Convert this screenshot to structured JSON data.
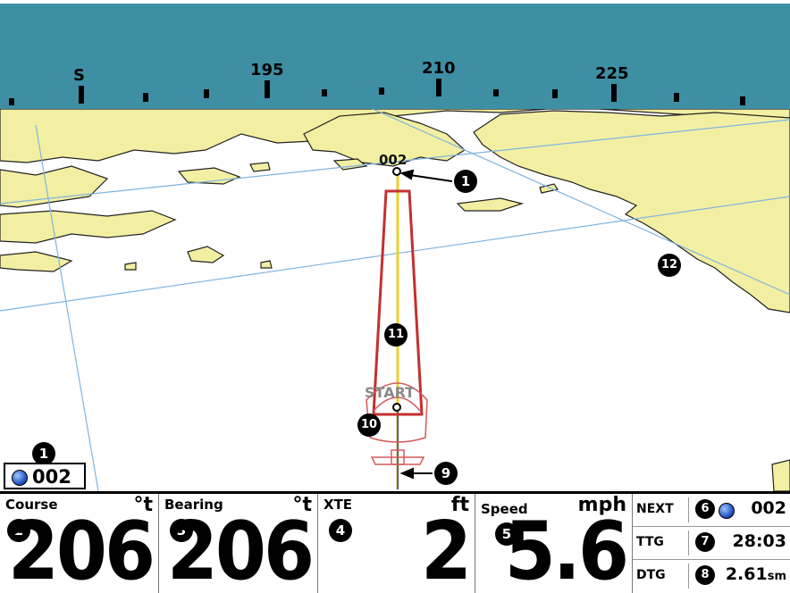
{
  "compass": {
    "labels": [
      "S",
      "195",
      "210",
      "225"
    ]
  },
  "map": {
    "waypoint_label": "002",
    "start_label": "START"
  },
  "callouts": [
    "1",
    "1",
    "2",
    "3",
    "4",
    "5",
    "6",
    "7",
    "8",
    "9",
    "10",
    "11",
    "12"
  ],
  "waypoint_box": {
    "number": "002"
  },
  "panel": {
    "course": {
      "title": "Course",
      "unit": "°t",
      "value": "206"
    },
    "bearing": {
      "title": "Bearing",
      "unit": "°t",
      "value": "206"
    },
    "xte": {
      "title": "XTE",
      "unit": "ft",
      "value": "2"
    },
    "speed": {
      "title": "Speed",
      "unit": "mph",
      "value": "5.6"
    },
    "next": {
      "label": "NEXT",
      "value": "002"
    },
    "ttg": {
      "label": "TTG",
      "value": "28:03"
    },
    "dtg": {
      "label": "DTG",
      "value": "2.61",
      "unit": "sm"
    }
  },
  "colors": {
    "sky": "#3f8fa4",
    "land": "#f3efa2",
    "water": "#ffffff",
    "grid": "#7fb4e0",
    "track": "#c43030",
    "route": "#e6d12c"
  }
}
